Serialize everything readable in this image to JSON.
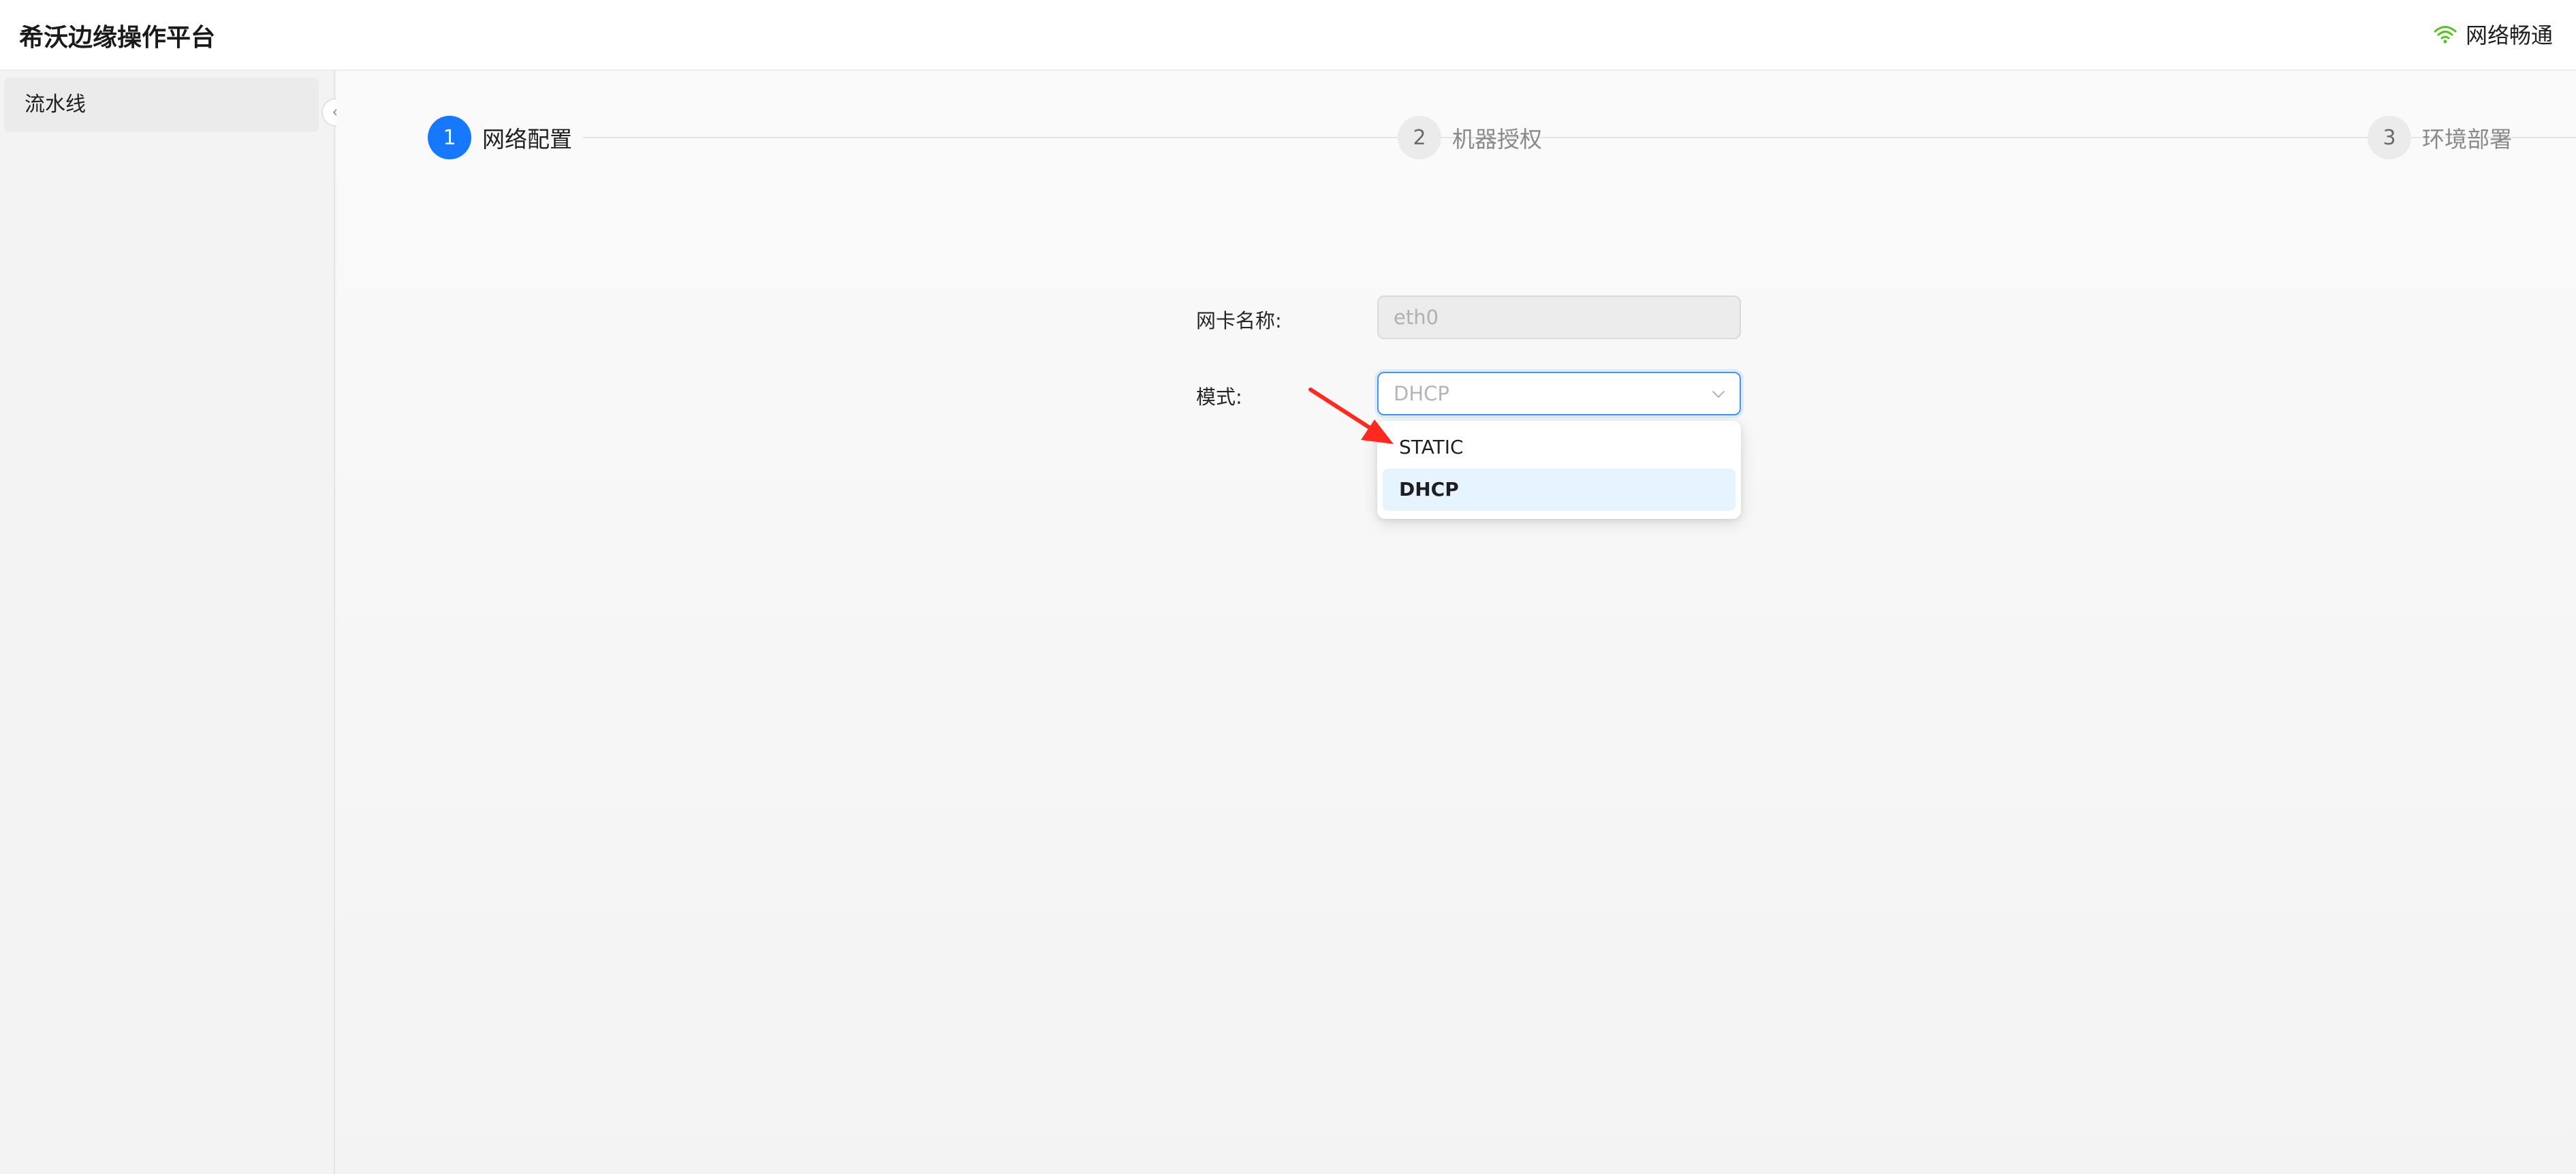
{
  "header": {
    "title": "希沃边缘操作平台",
    "network_status": "网络畅通",
    "network_icon": "wifi-icon",
    "network_color": "#52c41a"
  },
  "sidebar": {
    "items": [
      {
        "label": "流水线"
      }
    ],
    "collapse_icon": "chevron-left-icon"
  },
  "steps": [
    {
      "number": "1",
      "title": "网络配置",
      "status": "active"
    },
    {
      "number": "2",
      "title": "机器授权",
      "status": "wait"
    },
    {
      "number": "3",
      "title": "环境部署",
      "status": "wait"
    }
  ],
  "form": {
    "nic_label": "网卡名称:",
    "nic_value": "eth0",
    "mode_label": "模式:",
    "mode_selected": "DHCP",
    "mode_options": [
      "STATIC",
      "DHCP"
    ]
  },
  "colors": {
    "accent": "#1677ff",
    "annotation_arrow": "#ff2a1f"
  }
}
